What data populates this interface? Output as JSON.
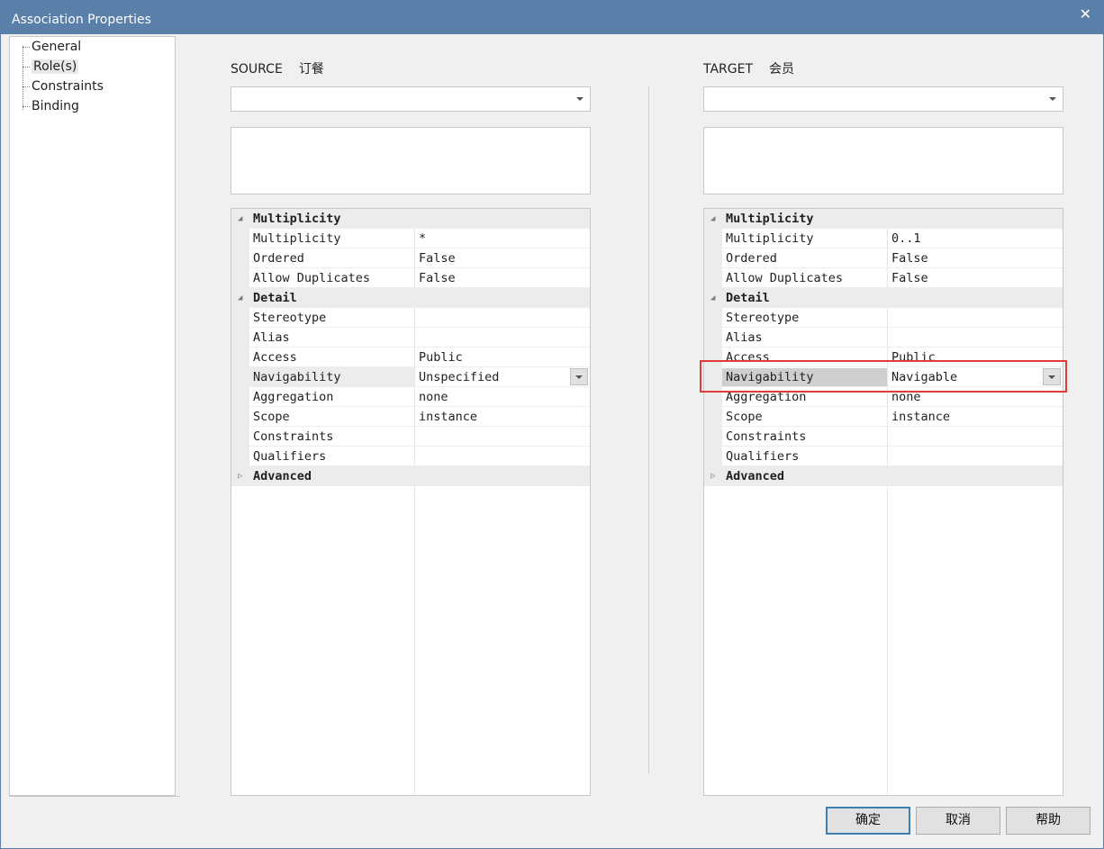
{
  "window": {
    "title": "Association Properties",
    "close_glyph": "✕"
  },
  "nav": {
    "items": [
      "General",
      "Role(s)",
      "Constraints",
      "Binding"
    ],
    "active": "Role(s)"
  },
  "source": {
    "label": "SOURCE",
    "name": "订餐",
    "dropdown_value": "",
    "categories": {
      "multiplicity": "Multiplicity",
      "detail": "Detail",
      "advanced": "Advanced"
    },
    "rows": {
      "multiplicity": {
        "name": "Multiplicity",
        "value": "*"
      },
      "ordered": {
        "name": "Ordered",
        "value": "False"
      },
      "allow_duplicates": {
        "name": "Allow Duplicates",
        "value": "False"
      },
      "stereotype": {
        "name": "Stereotype",
        "value": ""
      },
      "alias": {
        "name": "Alias",
        "value": ""
      },
      "access": {
        "name": "Access",
        "value": "Public"
      },
      "navigability": {
        "name": "Navigability",
        "value": "Unspecified"
      },
      "aggregation": {
        "name": "Aggregation",
        "value": "none"
      },
      "scope": {
        "name": "Scope",
        "value": "instance"
      },
      "constraints": {
        "name": "Constraints",
        "value": ""
      },
      "qualifiers": {
        "name": "Qualifiers",
        "value": ""
      }
    }
  },
  "target": {
    "label": "TARGET",
    "name": "会员",
    "dropdown_value": "",
    "categories": {
      "multiplicity": "Multiplicity",
      "detail": "Detail",
      "advanced": "Advanced"
    },
    "rows": {
      "multiplicity": {
        "name": "Multiplicity",
        "value": "0..1"
      },
      "ordered": {
        "name": "Ordered",
        "value": "False"
      },
      "allow_duplicates": {
        "name": "Allow Duplicates",
        "value": "False"
      },
      "stereotype": {
        "name": "Stereotype",
        "value": ""
      },
      "alias": {
        "name": "Alias",
        "value": ""
      },
      "access": {
        "name": "Access",
        "value": "Public"
      },
      "navigability": {
        "name": "Navigability",
        "value": "Navigable"
      },
      "aggregation": {
        "name": "Aggregation",
        "value": "none"
      },
      "scope": {
        "name": "Scope",
        "value": "instance"
      },
      "constraints": {
        "name": "Constraints",
        "value": ""
      },
      "qualifiers": {
        "name": "Qualifiers",
        "value": ""
      }
    }
  },
  "buttons": {
    "ok": "确定",
    "cancel": "取消",
    "help": "帮助"
  },
  "colors": {
    "titlebar": "#5a7fa8",
    "highlight": "#e03a3a"
  }
}
